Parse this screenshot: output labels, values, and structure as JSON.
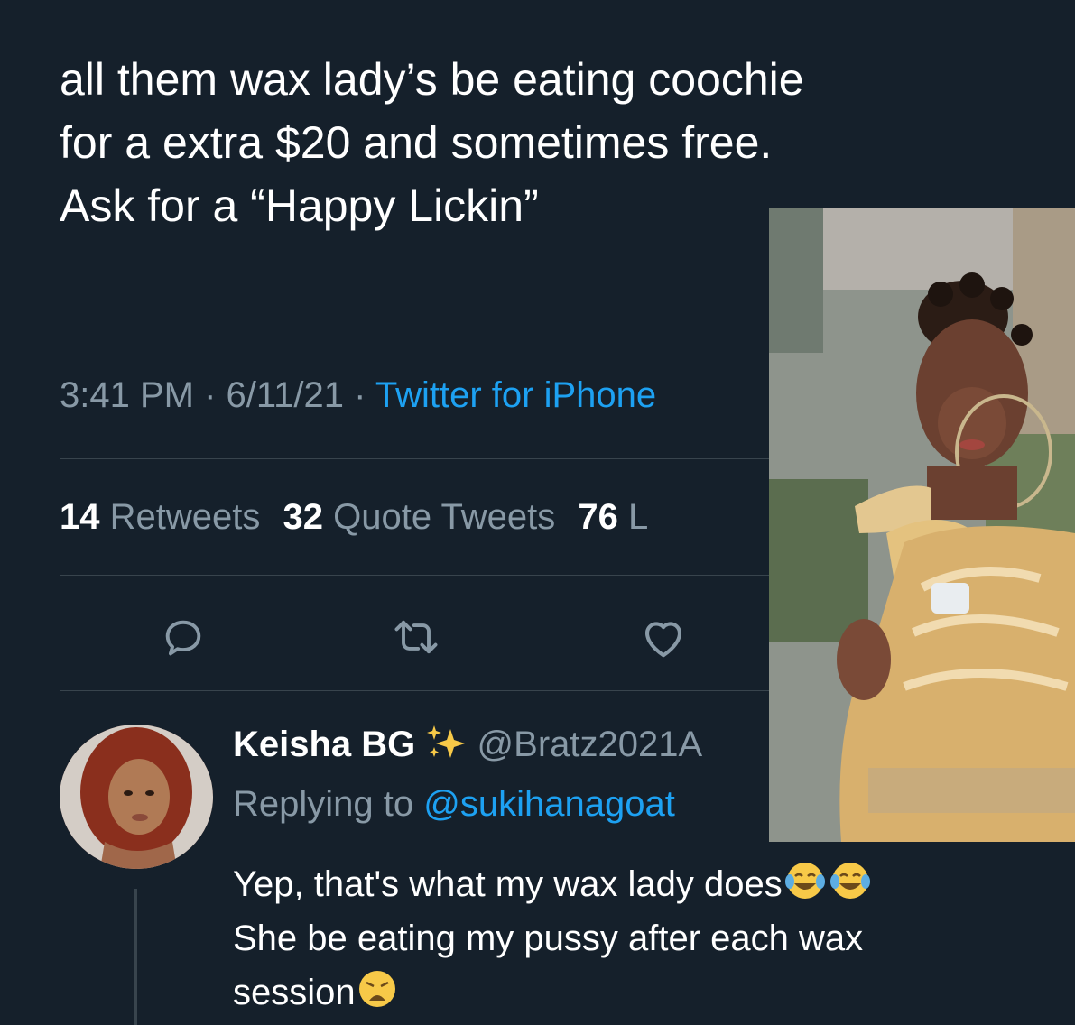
{
  "tweet": {
    "lines": [
      "all them wax lady’s be eating coochie",
      "for a extra $20 and sometimes free.",
      "Ask for a “Happy Lickin”"
    ],
    "time": "3:41 PM",
    "separator": "·",
    "date": "6/11/21",
    "source": "Twitter for iPhone"
  },
  "stats": {
    "retweets_count": "14",
    "retweets_label": "Retweets",
    "quotes_count": "32",
    "quotes_label": "Quote Tweets",
    "likes_count": "76",
    "likes_label": "L"
  },
  "actions": {
    "icons": [
      "reply-icon",
      "retweet-icon",
      "like-icon"
    ]
  },
  "reply": {
    "name": "Keisha BG",
    "handle": "@Bratz2021A",
    "replying_prefix": "Replying to",
    "replying_to": "@sukihanagoat",
    "lines": [
      "Yep, that's what my wax lady does",
      "She be eating my pussy after each wax",
      "session"
    ]
  },
  "colors": {
    "background": "#15202b",
    "text": "#ffffff",
    "muted": "#8899a6",
    "link": "#1da1f2",
    "divider": "#38444d"
  }
}
